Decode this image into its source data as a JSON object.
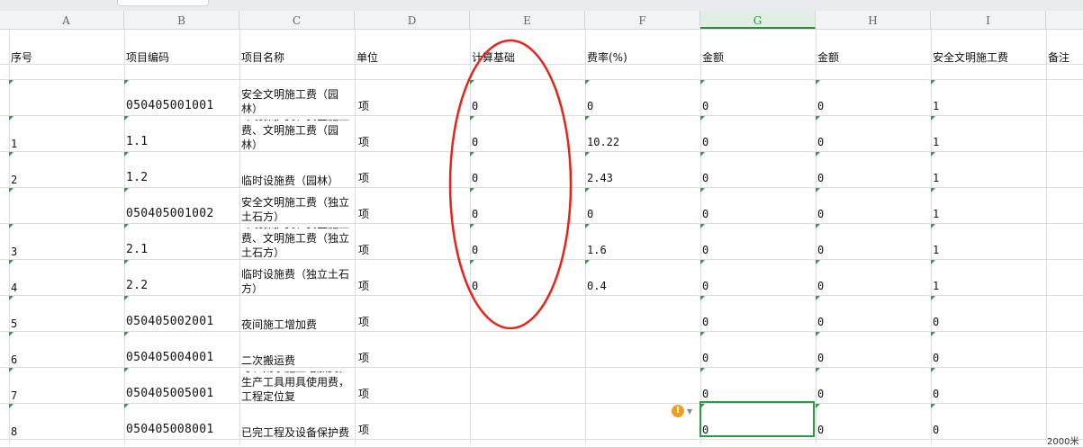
{
  "column_headers": [
    "A",
    "B",
    "C",
    "D",
    "E",
    "F",
    "G",
    "H",
    "I"
  ],
  "active_column": "G",
  "table": {
    "header": [
      "序号",
      "项目编码",
      "项目名称",
      "单位",
      "计算基础",
      "费率(%)",
      "金额",
      "金额",
      "安全文明施工费",
      "备注"
    ],
    "rows": [
      {
        "no": "",
        "code": "050405001001",
        "name": "安全文明施工费（园林）",
        "unit": "项",
        "base": "0",
        "rate": "0",
        "amt1": "0",
        "amt2": "0",
        "safety": "1"
      },
      {
        "no": "1",
        "code": "1.1",
        "name": "环境保护费、安全施工费、文明施工费（园林）",
        "unit": "项",
        "base": "0",
        "rate": "10.22",
        "amt1": "0",
        "amt2": "0",
        "safety": "1"
      },
      {
        "no": "2",
        "code": "1.2",
        "name": "临时设施费（园林）",
        "unit": "项",
        "base": "0",
        "rate": "2.43",
        "amt1": "0",
        "amt2": "0",
        "safety": "1"
      },
      {
        "no": "",
        "code": "050405001002",
        "name": "安全文明施工费（独立土石方）",
        "unit": "项",
        "base": "0",
        "rate": "0",
        "amt1": "0",
        "amt2": "0",
        "safety": "1"
      },
      {
        "no": "3",
        "code": "2.1",
        "name": "环境保护费、安全施工费、文明施工费（独立土石方）",
        "unit": "项",
        "base": "0",
        "rate": "1.6",
        "amt1": "0",
        "amt2": "0",
        "safety": "1"
      },
      {
        "no": "4",
        "code": "2.2",
        "name": "临时设施费（独立土石方）",
        "unit": "项",
        "base": "0",
        "rate": "0.4",
        "amt1": "0",
        "amt2": "0",
        "safety": "1"
      },
      {
        "no": "5",
        "code": "050405002001",
        "name": "夜间施工增加费",
        "unit": "项",
        "base": "",
        "rate": "",
        "amt1": "0",
        "amt2": "0",
        "safety": "0"
      },
      {
        "no": "6",
        "code": "050405004001",
        "name": "二次搬运费",
        "unit": "项",
        "base": "",
        "rate": "",
        "amt1": "0",
        "amt2": "0",
        "safety": "0"
      },
      {
        "no": "7",
        "code": "050405005001",
        "name": "冬、雨季施工增加费，生产工具用具使用费，工程定位复",
        "unit": "项",
        "base": "",
        "rate": "",
        "amt1": "0",
        "amt2": "0",
        "safety": "0"
      },
      {
        "no": "8",
        "code": "050405008001",
        "name": "已完工程及设备保护费",
        "unit": "项",
        "base": "",
        "rate": "",
        "amt1": "0",
        "amt2": "0",
        "safety": "0"
      }
    ]
  },
  "annotation": {
    "color": "#e8231a"
  },
  "edge_text": "2000米",
  "warning_icon": "exclamation-icon"
}
